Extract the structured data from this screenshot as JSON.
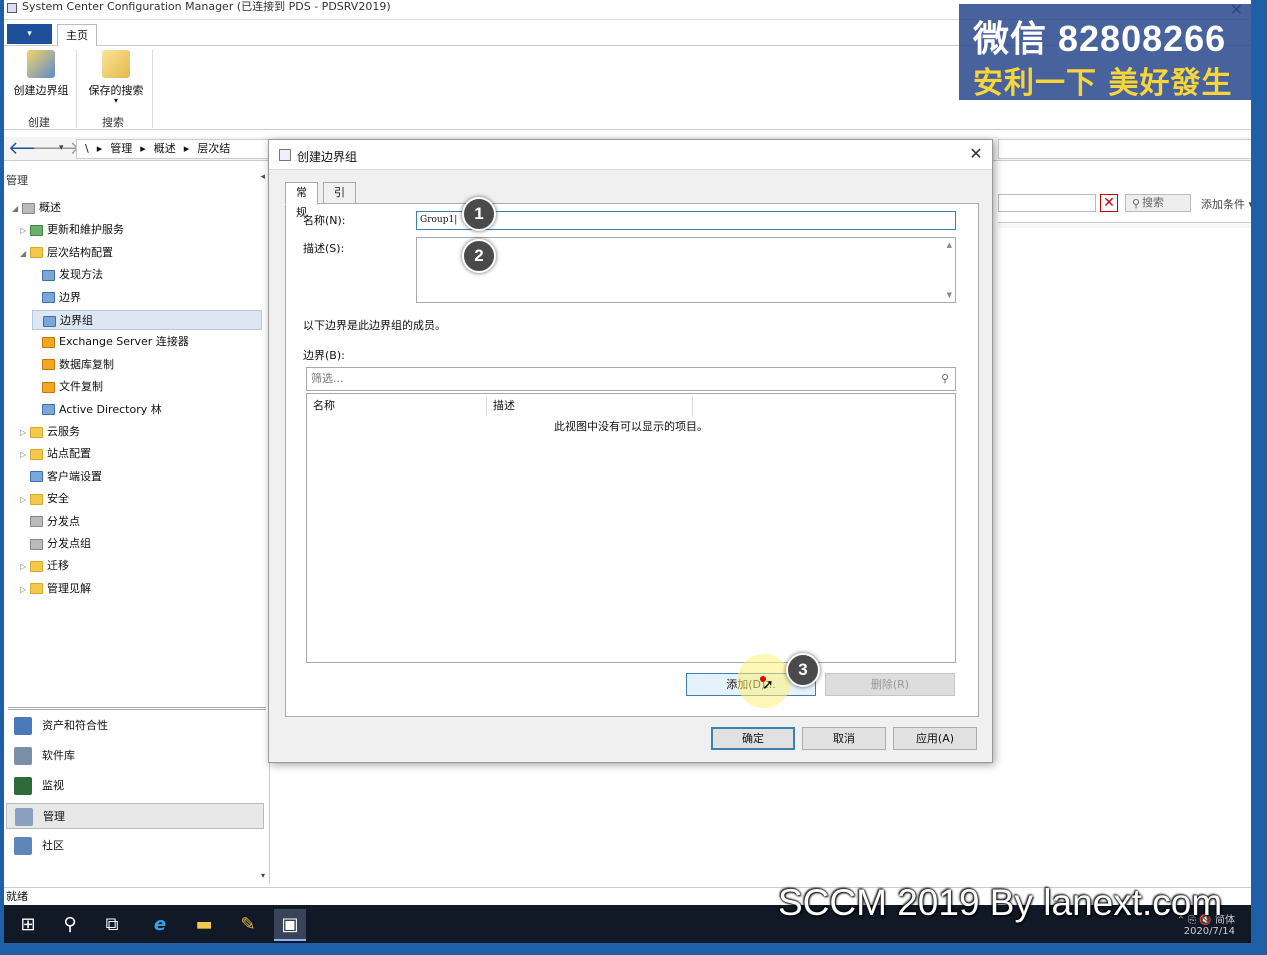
{
  "window": {
    "title": "System Center Configuration Manager (已连接到 PDS - PDSRV2019)",
    "close": "✕"
  },
  "ribbon": {
    "file_tab": "▾",
    "home_tab": "主页",
    "create_boundary_group": "创建边界组",
    "saved_searches": "保存的搜索",
    "saved_searches_arrow": "▾",
    "group_create": "创建",
    "group_search": "搜索"
  },
  "addressbar": {
    "back": "🡐",
    "forward": "🡒",
    "dropdown": "▾",
    "crumbs": [
      "\\",
      "▸",
      "管理",
      "▸",
      "概述",
      "▸",
      "层次结"
    ]
  },
  "navpane": {
    "header": "管理",
    "collapse": "◂",
    "tree": [
      {
        "label": "概述",
        "toggle": "◢",
        "level": 0,
        "icon": "overview-icon",
        "color": "gray"
      },
      {
        "label": "更新和維护服务",
        "toggle": "▷",
        "level": 1,
        "icon": "update-icon",
        "color": "green"
      },
      {
        "label": "层次结构配置",
        "toggle": "◢",
        "level": 1,
        "icon": "folder-icon",
        "color": "folder"
      },
      {
        "label": "发现方法",
        "toggle": "",
        "level": 2,
        "icon": "discovery-icon",
        "color": "blue"
      },
      {
        "label": "边界",
        "toggle": "",
        "level": 2,
        "icon": "boundary-icon",
        "color": "blue"
      },
      {
        "label": "边界组",
        "toggle": "",
        "level": 2,
        "icon": "boundary-group-icon",
        "color": "blue",
        "selected": true
      },
      {
        "label": "Exchange Server 连接器",
        "toggle": "",
        "level": 2,
        "icon": "exchange-icon",
        "color": "orange"
      },
      {
        "label": "数据库复制",
        "toggle": "",
        "level": 2,
        "icon": "database-icon",
        "color": "orange"
      },
      {
        "label": "文件复制",
        "toggle": "",
        "level": 2,
        "icon": "file-replication-icon",
        "color": "orange"
      },
      {
        "label": "Active Directory 林",
        "toggle": "",
        "level": 2,
        "icon": "ad-forest-icon",
        "color": "blue"
      },
      {
        "label": "云服务",
        "toggle": "▷",
        "level": 1,
        "icon": "folder-icon",
        "color": "folder"
      },
      {
        "label": "站点配置",
        "toggle": "▷",
        "level": 1,
        "icon": "folder-icon",
        "color": "folder"
      },
      {
        "label": "客户端设置",
        "toggle": "",
        "level": 1,
        "icon": "client-settings-icon",
        "color": "blue"
      },
      {
        "label": "安全",
        "toggle": "▷",
        "level": 1,
        "icon": "folder-icon",
        "color": "folder"
      },
      {
        "label": "分发点",
        "toggle": "",
        "level": 1,
        "icon": "distribution-point-icon",
        "color": "gray"
      },
      {
        "label": "分发点组",
        "toggle": "",
        "level": 1,
        "icon": "distribution-group-icon",
        "color": "gray"
      },
      {
        "label": "迁移",
        "toggle": "▷",
        "level": 1,
        "icon": "folder-icon",
        "color": "folder"
      },
      {
        "label": "管理见解",
        "toggle": "▷",
        "level": 1,
        "icon": "folder-icon",
        "color": "folder"
      }
    ],
    "workspaces": [
      {
        "label": "资产和符合性",
        "icon": "assets-icon",
        "color": "#4a78b8"
      },
      {
        "label": "软件库",
        "icon": "software-library-icon",
        "color": "#7a8fa8"
      },
      {
        "label": "监视",
        "icon": "monitoring-icon",
        "color": "#2f6a3a"
      },
      {
        "label": "管理",
        "icon": "administration-icon",
        "color": "#8aa0c0",
        "selected": true
      },
      {
        "label": "社区",
        "icon": "community-icon",
        "color": "#5f86b8"
      }
    ],
    "scroll_down": "▾"
  },
  "rightpane": {
    "search_label": "搜索",
    "add_criteria": "添加条件 ▾",
    "clear": "✕",
    "magnifier": "⚲"
  },
  "statusbar": {
    "text": "就绪"
  },
  "dialog": {
    "title": "创建边界组",
    "close": "✕",
    "tabs": [
      "常规",
      "引用"
    ],
    "name_label": "名称(N):",
    "name_value": "Group1|",
    "desc_label": "描述(S):",
    "desc_scroll_up": "▲",
    "desc_scroll_down": "▼",
    "members_text": "以下边界是此边界组的成员。",
    "boundaries_label": "边界(B):",
    "filter_placeholder": "筛选...",
    "filter_icon": "⚲",
    "columns": [
      "名称",
      "描述"
    ],
    "empty_text": "此视图中没有可以显示的项目。",
    "add_button": "添加(D)...",
    "remove_button": "删除(R)",
    "ok": "确定",
    "cancel": "取消",
    "apply": "应用(A)"
  },
  "callouts": [
    "1",
    "2",
    "3"
  ],
  "overlay": {
    "wechat_line1": "微信 82808266",
    "wechat_line2": "安利一下 美好發生",
    "watermark": "SCCM 2019 By lanext.com"
  },
  "taskbar": {
    "start": "⊞",
    "search": "⚲",
    "taskview": "⧉",
    "ie": "e",
    "explorer": "▬",
    "server_manager": "✎",
    "console": "▣",
    "tray_icons": "⌃ ⎘ 🔇 简体",
    "date": "2020/7/14"
  }
}
